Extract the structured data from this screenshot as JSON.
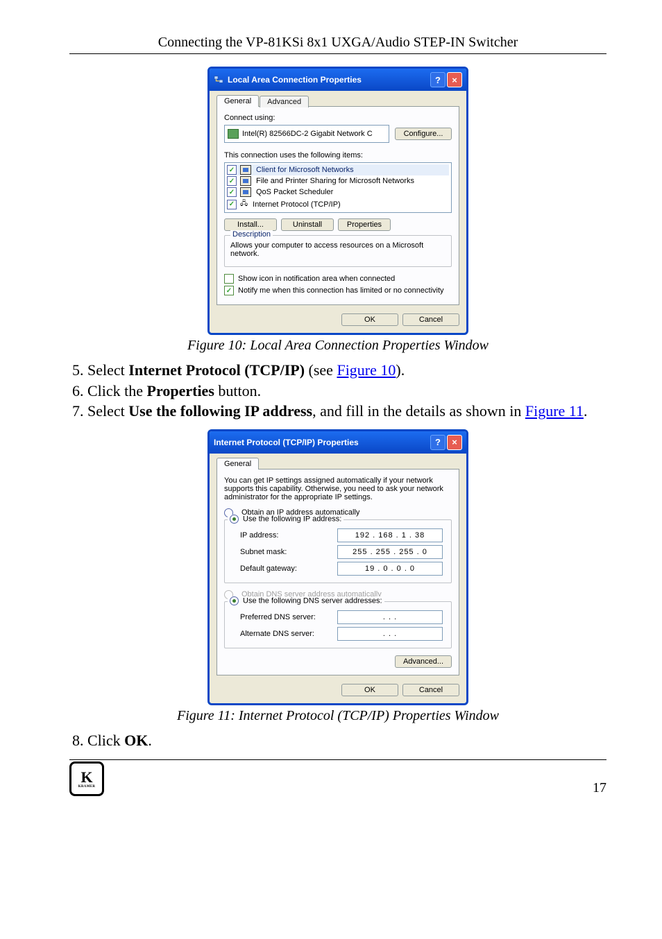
{
  "header": "Connecting the VP-81KSi 8x1 UXGA/Audio STEP-IN Switcher",
  "fig10": {
    "caption": "Figure 10: Local Area Connection Properties Window",
    "title": "Local Area Connection Properties",
    "tabs": {
      "general": "General",
      "advanced": "Advanced"
    },
    "connect_using": "Connect using:",
    "adapter": "Intel(R) 82566DC-2 Gigabit Network C",
    "configure": "Configure...",
    "uses": "This connection uses the following items:",
    "items": [
      "Client for Microsoft Networks",
      "File and Printer Sharing for Microsoft Networks",
      "QoS Packet Scheduler",
      "Internet Protocol (TCP/IP)"
    ],
    "install": "Install...",
    "uninstall": "Uninstall",
    "properties": "Properties",
    "desc_t": "Description",
    "desc": "Allows your computer to access resources on a Microsoft network.",
    "notify1": "Show icon in notification area when connected",
    "notify2": "Notify me when this connection has limited or no connectivity",
    "ok": "OK",
    "cancel": "Cancel"
  },
  "steps": [
    {
      "n": "5",
      "pre": "Select ",
      "bold": "Internet Protocol (TCP/IP)",
      "post": " (see ",
      "link": "Figure 10",
      "tail": ")."
    },
    {
      "n": "6",
      "pre": "Click the ",
      "bold": "Properties",
      "post": " button."
    },
    {
      "n": "7",
      "pre": "Select ",
      "bold": "Use the following IP address",
      "post": ", and fill in the details as shown in ",
      "link": "Figure 11",
      "tail": "."
    }
  ],
  "fig11": {
    "caption": "Figure 11: Internet Protocol (TCP/IP) Properties Window",
    "title": "Internet Protocol (TCP/IP) Properties",
    "tab": "General",
    "blurb": "You can get IP settings assigned automatically if your network supports this capability. Otherwise, you need to ask your network administrator for the appropriate IP settings.",
    "r1": "Obtain an IP address automatically",
    "r2": "Use the following IP address:",
    "ip_l": "IP address:",
    "ip_v": "192 . 168 .   1   .  38",
    "sm_l": "Subnet mask:",
    "sm_v": "255 . 255 . 255 .   0",
    "gw_l": "Default gateway:",
    "gw_v": "19  .   0   .   0   .   0",
    "r3": "Obtain DNS server address automatically",
    "r4": "Use the following DNS server addresses:",
    "pd_l": "Preferred DNS server:",
    "pd_v": ".       .       .",
    "ad_l": "Alternate DNS server:",
    "ad_v": ".       .       .",
    "adv": "Advanced...",
    "ok": "OK",
    "cancel": "Cancel"
  },
  "step8": {
    "n": "8",
    "pre": "Click ",
    "bold": "OK",
    "post": "."
  },
  "page": "17",
  "logo": "KRAMER"
}
